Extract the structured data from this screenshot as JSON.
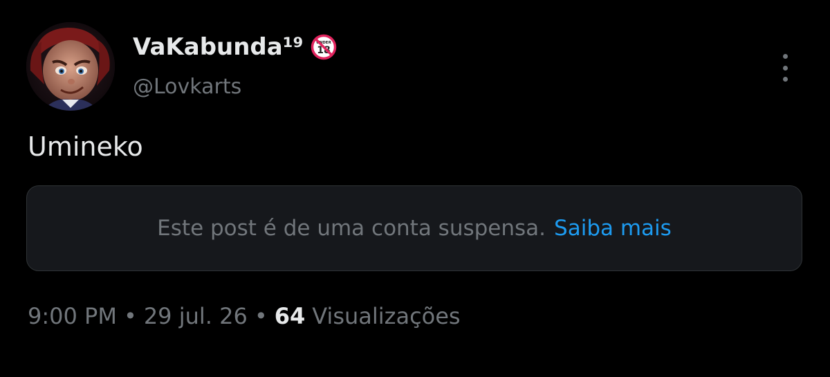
{
  "author": {
    "display_name": "VaKabunda¹⁹",
    "handle": "@Lovkarts",
    "badge_icon": "under-18-icon",
    "badge_text": "UNDER",
    "badge_number": "18"
  },
  "post": {
    "text": "Umineko",
    "notice": {
      "text": "Este post é de uma conta suspensa.",
      "link_text": "Saiba mais"
    },
    "meta": {
      "time": "9:00 PM",
      "separator": "•",
      "date": "29 jul. 26",
      "views_count": "64",
      "views_label": "Visualizações"
    }
  },
  "menu": {
    "icon": "more-options-icon"
  },
  "colors": {
    "background": "#000000",
    "primary_text": "#e7e9ea",
    "secondary_text": "#71767b",
    "link": "#1d9bf0",
    "notice_bg": "#16181c",
    "notice_border": "#2f3336",
    "badge_red": "#e0245e"
  }
}
